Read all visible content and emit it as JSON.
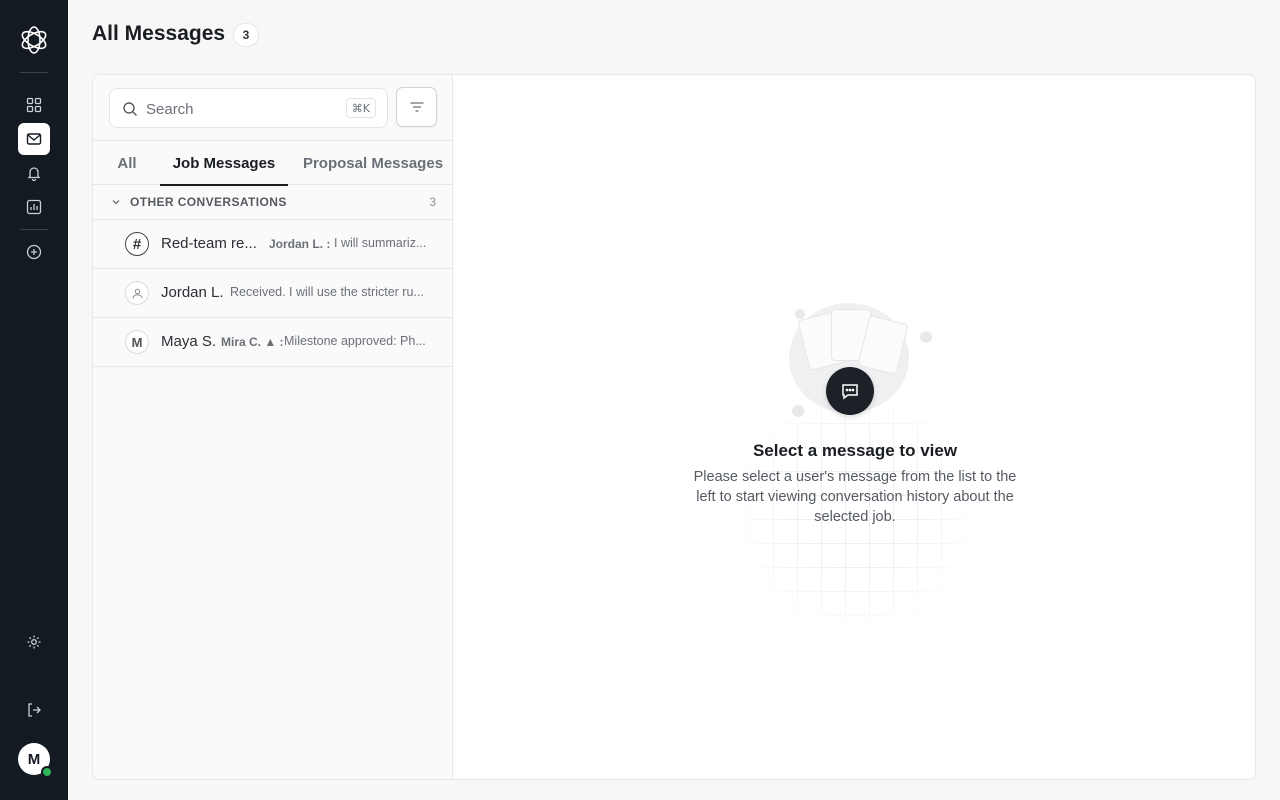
{
  "header": {
    "title": "All Messages",
    "count": "3"
  },
  "search": {
    "placeholder": "Search",
    "shortcut": "⌘K"
  },
  "tabs": [
    {
      "label": "All"
    },
    {
      "label": "Job Messages"
    },
    {
      "label": "Proposal Messages"
    }
  ],
  "group": {
    "title": "OTHER CONVERSATIONS",
    "count": "3"
  },
  "conversations": [
    {
      "icon": "hash",
      "name": "Red-team re...",
      "sender": "Jordan L. :",
      "preview": "I will summariz..."
    },
    {
      "icon": "user",
      "name": "Jordan L.",
      "sender": "",
      "preview": "Received. I will use the stricter ru..."
    },
    {
      "icon": "M",
      "name": "Maya S.",
      "sender": "Mira C. ▲ :",
      "preview": "Milestone approved: Ph..."
    }
  ],
  "empty_state": {
    "title": "Select a message to view",
    "description": "Please select a user's message from the list to the left to start viewing conversation history about the selected job."
  },
  "user": {
    "initial": "M",
    "status": "online"
  },
  "colors": {
    "sidebar": "#141a22",
    "accent": "#1a1d21",
    "online": "#2fb45a"
  }
}
